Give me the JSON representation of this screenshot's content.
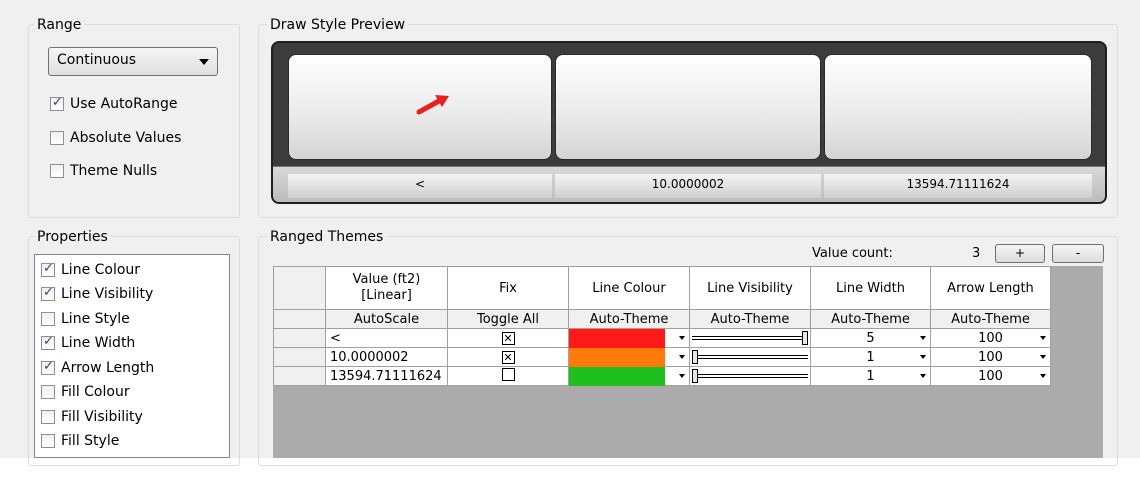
{
  "range": {
    "title": "Range",
    "mode": "Continuous",
    "use_autorange": {
      "label": "Use AutoRange",
      "checked": true
    },
    "absolute_values": {
      "label": "Absolute Values",
      "checked": false
    },
    "theme_nulls": {
      "label": "Theme Nulls",
      "checked": false
    }
  },
  "preview": {
    "title": "Draw Style Preview",
    "labels": [
      "<",
      "10.0000002",
      "13594.71111624"
    ],
    "arrow_color": "#e8201e"
  },
  "properties": {
    "title": "Properties",
    "items": [
      {
        "label": "Line Colour",
        "checked": true
      },
      {
        "label": "Line Visibility",
        "checked": true
      },
      {
        "label": "Line Style",
        "checked": false
      },
      {
        "label": "Line Width",
        "checked": true
      },
      {
        "label": "Arrow Length",
        "checked": true
      },
      {
        "label": "Fill Colour",
        "checked": false
      },
      {
        "label": "Fill Visibility",
        "checked": false
      },
      {
        "label": "Fill Style",
        "checked": false
      }
    ]
  },
  "themes": {
    "title": "Ranged Themes",
    "value_count_label": "Value count:",
    "value_count": "3",
    "add_label": "+",
    "remove_label": "-",
    "headers": {
      "value": "Value (ft2)",
      "value_sub": "[Linear]",
      "fix": "Fix",
      "line_colour": "Line Colour",
      "line_visibility": "Line Visibility",
      "line_width": "Line Width",
      "arrow_length": "Arrow Length"
    },
    "subheaders": {
      "value": "AutoScale",
      "fix": "Toggle All",
      "line_colour": "Auto-Theme",
      "line_visibility": "Auto-Theme",
      "line_width": "Auto-Theme",
      "arrow_length": "Auto-Theme"
    },
    "rows": [
      {
        "value": "<",
        "fix": true,
        "colour": "#ff1a1a",
        "visibility": 1.0,
        "width": "5",
        "arrow": "100"
      },
      {
        "value": "10.0000002",
        "fix": true,
        "colour": "#ff7a0a",
        "visibility": 0.0,
        "width": "1",
        "arrow": "100"
      },
      {
        "value": "13594.71111624",
        "fix": false,
        "colour": "#1fbf1f",
        "visibility": 0.0,
        "width": "1",
        "arrow": "100"
      }
    ]
  }
}
